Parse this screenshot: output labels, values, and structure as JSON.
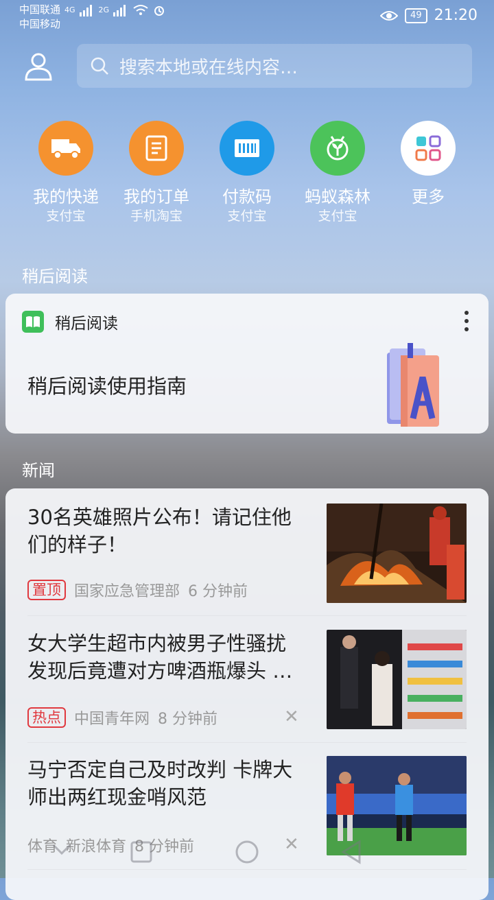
{
  "status": {
    "carrier1": "中国联通",
    "net1": "4G",
    "carrier2": "中国移动",
    "net2": "2G",
    "battery": "49",
    "time": "21:20"
  },
  "search": {
    "placeholder": "搜索本地或在线内容…"
  },
  "shortcuts": [
    {
      "title": "我的快递",
      "sub": "支付宝",
      "color": "#f5922f",
      "icon": "truck-icon"
    },
    {
      "title": "我的订单",
      "sub": "手机淘宝",
      "color": "#f5922f",
      "icon": "document-icon"
    },
    {
      "title": "付款码",
      "sub": "支付宝",
      "color": "#1f9ae8",
      "icon": "barcode-icon"
    },
    {
      "title": "蚂蚁森林",
      "sub": "支付宝",
      "color": "#4cc35a",
      "icon": "sprout-icon"
    },
    {
      "title": "更多",
      "sub": "",
      "color": "#ffffff",
      "icon": "grid-icon"
    }
  ],
  "read_later": {
    "section": "稍后阅读",
    "card_title": "稍后阅读",
    "guide": "稍后阅读使用指南"
  },
  "news": {
    "section": "新闻",
    "items": [
      {
        "title": "30名英雄照片公布！请记住他们的样子！",
        "tag": "置顶",
        "source": "国家应急管理部",
        "time": "6 分钟前"
      },
      {
        "title": "女大学生超市内被男子性骚扰发现后竟遭对方啤酒瓶爆头 …",
        "tag": "热点",
        "source": "中国青年网",
        "time": "8 分钟前"
      },
      {
        "title": "马宁否定自己及时改判 卡牌大师出两红现金哨风范",
        "category": "体育",
        "source": "新浪体育",
        "time": "8 分钟前"
      }
    ]
  },
  "colors": {
    "tag_red": "#e0383e"
  }
}
